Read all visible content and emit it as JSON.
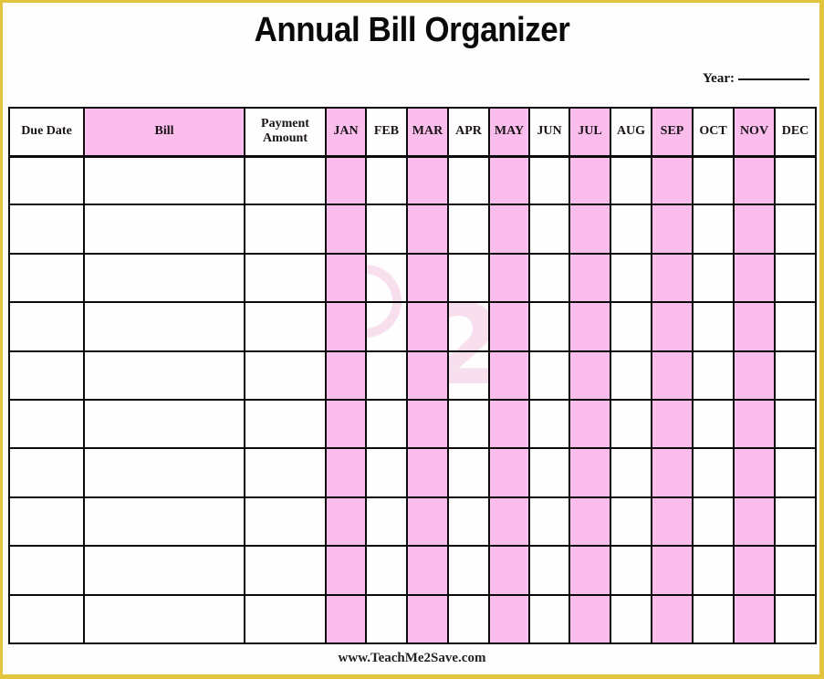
{
  "page": {
    "title": "Annual Bill Organizer",
    "year_label": "Year:",
    "year_value": "",
    "footer_url": "www.TeachMe2Save.com",
    "accent_color": "#fbbdeb",
    "frame_color": "#e3c53d"
  },
  "table": {
    "columns": [
      {
        "key": "due_date",
        "label": "Due Date",
        "highlight": false
      },
      {
        "key": "bill",
        "label": "Bill",
        "highlight": true
      },
      {
        "key": "payment_amount",
        "label": "Payment Amount",
        "highlight": false
      },
      {
        "key": "jan",
        "label": "JAN",
        "highlight": true
      },
      {
        "key": "feb",
        "label": "FEB",
        "highlight": false
      },
      {
        "key": "mar",
        "label": "MAR",
        "highlight": true
      },
      {
        "key": "apr",
        "label": "APR",
        "highlight": false
      },
      {
        "key": "may",
        "label": "MAY",
        "highlight": true
      },
      {
        "key": "jun",
        "label": "JUN",
        "highlight": false
      },
      {
        "key": "jul",
        "label": "JUL",
        "highlight": true
      },
      {
        "key": "aug",
        "label": "AUG",
        "highlight": false
      },
      {
        "key": "sep",
        "label": "SEP",
        "highlight": true
      },
      {
        "key": "oct",
        "label": "OCT",
        "highlight": false
      },
      {
        "key": "nov",
        "label": "NOV",
        "highlight": true
      },
      {
        "key": "dec",
        "label": "DEC",
        "highlight": false
      }
    ],
    "rows": [
      [
        "",
        "",
        "",
        "",
        "",
        "",
        "",
        "",
        "",
        "",
        "",
        "",
        "",
        "",
        ""
      ],
      [
        "",
        "",
        "",
        "",
        "",
        "",
        "",
        "",
        "",
        "",
        "",
        "",
        "",
        "",
        ""
      ],
      [
        "",
        "",
        "",
        "",
        "",
        "",
        "",
        "",
        "",
        "",
        "",
        "",
        "",
        "",
        ""
      ],
      [
        "",
        "",
        "",
        "",
        "",
        "",
        "",
        "",
        "",
        "",
        "",
        "",
        "",
        "",
        ""
      ],
      [
        "",
        "",
        "",
        "",
        "",
        "",
        "",
        "",
        "",
        "",
        "",
        "",
        "",
        "",
        ""
      ],
      [
        "",
        "",
        "",
        "",
        "",
        "",
        "",
        "",
        "",
        "",
        "",
        "",
        "",
        "",
        ""
      ],
      [
        "",
        "",
        "",
        "",
        "",
        "",
        "",
        "",
        "",
        "",
        "",
        "",
        "",
        "",
        ""
      ],
      [
        "",
        "",
        "",
        "",
        "",
        "",
        "",
        "",
        "",
        "",
        "",
        "",
        "",
        "",
        ""
      ],
      [
        "",
        "",
        "",
        "",
        "",
        "",
        "",
        "",
        "",
        "",
        "",
        "",
        "",
        "",
        ""
      ],
      [
        "",
        "",
        "",
        "",
        "",
        "",
        "",
        "",
        "",
        "",
        "",
        "",
        "",
        "",
        ""
      ]
    ]
  }
}
